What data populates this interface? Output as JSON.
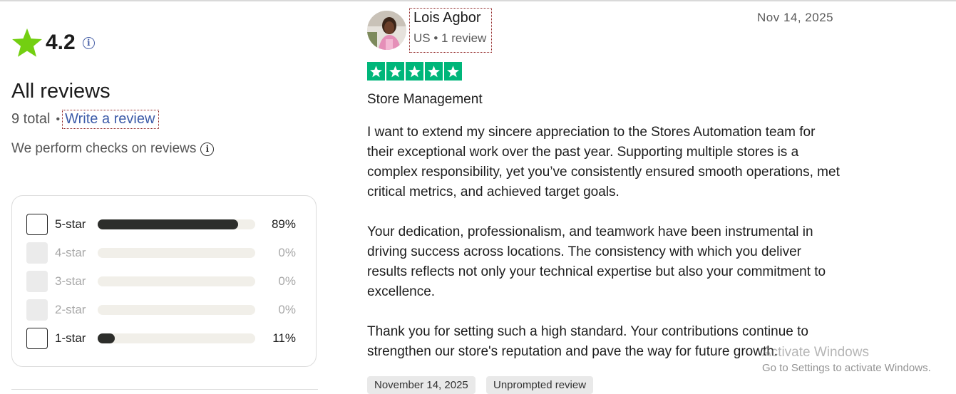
{
  "summary": {
    "rating": "4.2",
    "info_symbol": "i",
    "heading": "All reviews",
    "total": "9 total",
    "separator": "•",
    "write_review": "Write a review",
    "checks_text": "We perform checks on reviews"
  },
  "distribution": [
    {
      "label": "5-star",
      "percent": "89%",
      "fraction": 0.89,
      "enabled": true
    },
    {
      "label": "4-star",
      "percent": "0%",
      "fraction": 0,
      "enabled": false
    },
    {
      "label": "3-star",
      "percent": "0%",
      "fraction": 0,
      "enabled": false
    },
    {
      "label": "2-star",
      "percent": "0%",
      "fraction": 0,
      "enabled": false
    },
    {
      "label": "1-star",
      "percent": "11%",
      "fraction": 0.11,
      "enabled": true
    }
  ],
  "review": {
    "reviewer_name": "Lois Agbor",
    "reviewer_meta": "US • 1 review",
    "date": "Nov 14, 2025",
    "stars": 5,
    "title": "Store Management",
    "paragraphs": [
      "I want to extend my sincere appreciation to the Stores Automation team for their exceptional work over the past year. Supporting multiple stores is a complex responsibility, yet you’ve consistently ensured smooth operations, met critical metrics, and achieved target goals.",
      "Your dedication, professionalism, and teamwork have been instrumental in driving success across locations. The consistency with which you deliver results reflects not only your technical expertise but also your commitment to excellence.",
      "Thank you for setting such a high standard. Your contributions continue to strengthen our store's reputation and pave the way for future growth."
    ],
    "badges": [
      "November 14, 2025",
      "Unprompted review"
    ]
  },
  "windows_overlay": {
    "line1": "Activate Windows",
    "line2": "Go to Settings to activate Windows."
  },
  "colors": {
    "star_green": "#00b67a",
    "rating_star": "#73cf11",
    "link_blue": "#3c5ba8",
    "bar_fill": "#2d2e2b"
  }
}
